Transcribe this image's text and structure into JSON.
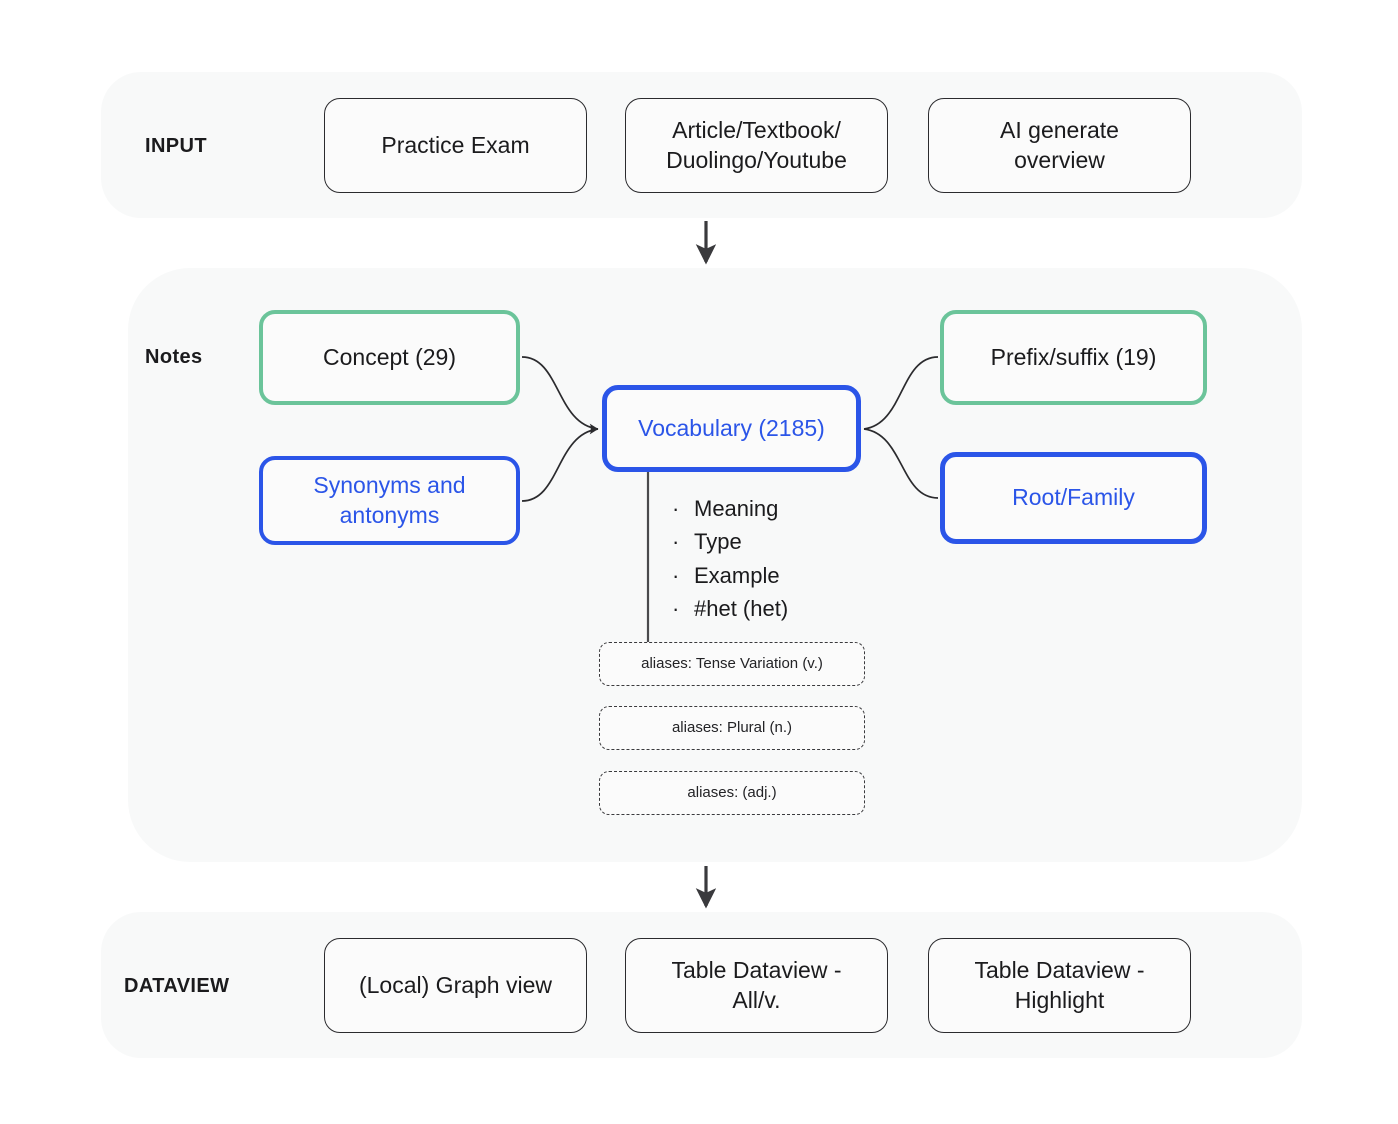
{
  "sections": {
    "input": {
      "label": "INPUT",
      "nodes": [
        {
          "label": "Practice Exam"
        },
        {
          "label_line1": "Article/Textbook/",
          "label_line2": "Duolingo/Youtube"
        },
        {
          "label_line1": "AI generate",
          "label_line2": "overview"
        }
      ]
    },
    "notes": {
      "label": "Notes",
      "concept": "Concept (29)",
      "synonyms_line1": "Synonyms and",
      "synonyms_line2": "antonyms",
      "vocabulary": "Vocabulary (2185)",
      "prefix_suffix": "Prefix/suffix (19)",
      "root_family": "Root/Family",
      "bullets": [
        "Meaning",
        "Type",
        "Example",
        "#het (het)"
      ],
      "bullet_marker": "·",
      "aliases": [
        "aliases: Tense Variation (v.)",
        "aliases: Plural (n.)",
        "aliases: (adj.)"
      ]
    },
    "dataview": {
      "label": "DATAVIEW",
      "nodes": [
        {
          "label": "(Local) Graph view"
        },
        {
          "label_line1": "Table Dataview -",
          "label_line2": "All/v."
        },
        {
          "label_line1": "Table Dataview -",
          "label_line2": "Highlight"
        }
      ]
    }
  },
  "colors": {
    "page_background": "#ffffff",
    "panel_background": "#f8f9f9",
    "node_background": "#fbfbfb",
    "green_border": "#6bc49a",
    "blue_border": "#2b55e8",
    "blue_text": "#2b55e8",
    "plain_border": "#2b2b2e",
    "text": "#1b1b1d",
    "connector": "#3a3a3d"
  }
}
